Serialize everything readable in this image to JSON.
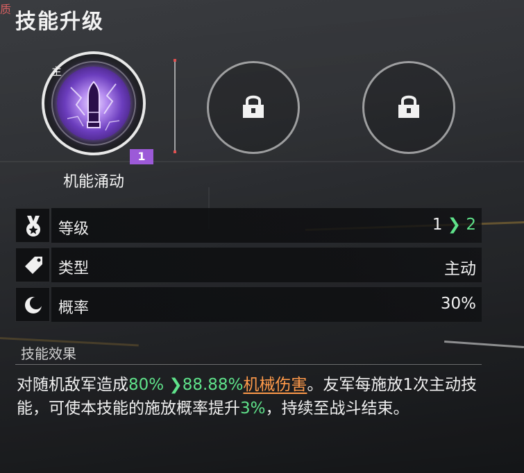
{
  "header": {
    "title": "技能升级",
    "corner_char": "质"
  },
  "main_skill": {
    "tag": "主",
    "level": "1",
    "name": "机能涌动",
    "icon": "bullet-lightning-icon"
  },
  "locked_slots": [
    {
      "icon": "lock-icon"
    },
    {
      "icon": "lock-icon"
    }
  ],
  "stats": {
    "level": {
      "label": "等级",
      "from": "1",
      "to": "2",
      "icon": "medal-icon"
    },
    "type": {
      "label": "类型",
      "value": "主动",
      "icon": "tag-icon"
    },
    "rate": {
      "label": "概率",
      "value": "30%",
      "icon": "moon-icon"
    }
  },
  "effect": {
    "heading": "技能效果",
    "t1": "对随机敌军造成",
    "v1": "80%",
    "v2": "88.88%",
    "dmg": "机械伤害",
    "t2": "。友军每施放1次主动技能，可使本技能的施放概率提升",
    "v3": "3%",
    "t3": "，持续至战斗结束。"
  },
  "colors": {
    "accent_green": "#5fe28a",
    "accent_orange": "#ff9a4a",
    "badge_purple": "#9c5ad8"
  }
}
